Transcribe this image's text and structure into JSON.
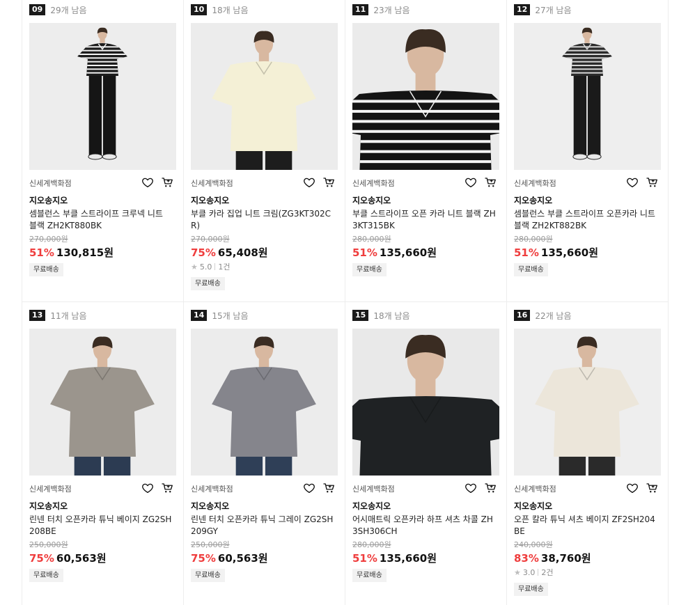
{
  "colors": {
    "discount": "#ef3d3d",
    "rank_bg": "#1a1a1a",
    "badge_bg": "#f2f2f2"
  },
  "icons": {
    "wishlist": "heart-icon",
    "cart": "cart-icon",
    "rating": "star-icon"
  },
  "products": [
    {
      "rank": "09",
      "remain": "29개 남음",
      "store": "신세계백화점",
      "brand": "지오송지오",
      "name": "셈블런스 부클 스트라이프 크루넥 니트 블랙 ZH2KT880BK",
      "original_price": "270,000원",
      "discount": "51%",
      "price": "130,815원",
      "rating": "",
      "reviews": "",
      "shipping": "무료배송",
      "shirt_color": "#1b1b1b",
      "pants_color": "#151515",
      "pattern": "stripes",
      "stripe_color": "#f2f2f2",
      "bg_color": "#ededed",
      "crop": "full"
    },
    {
      "rank": "10",
      "remain": "18개 남음",
      "store": "신세계백화점",
      "brand": "지오송지오",
      "name": "부클 카라 집업 니트 크림(ZG3KT302CR)",
      "original_price": "270,000원",
      "discount": "75%",
      "price": "65,408원",
      "rating": "5.0",
      "reviews": "1건",
      "shipping": "무료배송",
      "shirt_color": "#f4f0d6",
      "pants_color": "#1d1d1d",
      "pattern": "solid",
      "stripe_color": "",
      "bg_color": "#ececec",
      "crop": "mid"
    },
    {
      "rank": "11",
      "remain": "23개 남음",
      "store": "신세계백화점",
      "brand": "지오송지오",
      "name": "부클 스트라이프 오픈 카라 니트 블랙 ZH3KT315BK",
      "original_price": "280,000원",
      "discount": "51%",
      "price": "135,660원",
      "rating": "",
      "reviews": "",
      "shipping": "무료배송",
      "shirt_color": "#141414",
      "pants_color": "#141414",
      "pattern": "stripes",
      "stripe_color": "#f4f4f4",
      "bg_color": "#ebebeb",
      "crop": "close"
    },
    {
      "rank": "12",
      "remain": "27개 남음",
      "store": "신세계백화점",
      "brand": "지오송지오",
      "name": "셈블런스 부클 스트라이프 오픈카라 니트 블랙 ZH2KT882BK",
      "original_price": "280,000원",
      "discount": "51%",
      "price": "135,660원",
      "rating": "",
      "reviews": "",
      "shipping": "무료배송",
      "shirt_color": "#2a2a2a",
      "pants_color": "#1a1a1a",
      "pattern": "stripes",
      "stripe_color": "#d7d7d7",
      "bg_color": "#eeeeee",
      "crop": "full"
    },
    {
      "rank": "13",
      "remain": "11개 남음",
      "store": "신세계백화점",
      "brand": "지오송지오",
      "name": "린넨 터치 오픈카라 튜닉 베이지 ZG2SH208BE",
      "original_price": "250,000원",
      "discount": "75%",
      "price": "60,563원",
      "rating": "",
      "reviews": "",
      "shipping": "무료배송",
      "shirt_color": "#9b958d",
      "pants_color": "#2c3b52",
      "pattern": "solid",
      "stripe_color": "",
      "bg_color": "#ececec",
      "crop": "mid"
    },
    {
      "rank": "14",
      "remain": "15개 남음",
      "store": "신세계백화점",
      "brand": "지오송지오",
      "name": "린넨 터치 오픈카라 튜닉 그레이 ZG2SH209GY",
      "original_price": "250,000원",
      "discount": "75%",
      "price": "60,563원",
      "rating": "",
      "reviews": "",
      "shipping": "무료배송",
      "shirt_color": "#85858c",
      "pants_color": "#2f3f57",
      "pattern": "solid",
      "stripe_color": "",
      "bg_color": "#ececec",
      "crop": "mid"
    },
    {
      "rank": "15",
      "remain": "18개 남음",
      "store": "신세계백화점",
      "brand": "지오송지오",
      "name": "어시매트릭 오픈카라 하프 셔츠 차콜 ZH3SH306CH",
      "original_price": "280,000원",
      "discount": "51%",
      "price": "135,660원",
      "rating": "",
      "reviews": "",
      "shipping": "무료배송",
      "shirt_color": "#1f2224",
      "pants_color": "#1a1a1a",
      "pattern": "solid",
      "stripe_color": "",
      "bg_color": "#e9e9e9",
      "crop": "close"
    },
    {
      "rank": "16",
      "remain": "22개 남음",
      "store": "신세계백화점",
      "brand": "지오송지오",
      "name": "오픈 칼라 튜닉 셔츠 베이지 ZF2SH204BE",
      "original_price": "240,000원",
      "discount": "83%",
      "price": "38,760원",
      "rating": "3.0",
      "reviews": "2건",
      "shipping": "무료배송",
      "shirt_color": "#ece6da",
      "pants_color": "#2a2a2a",
      "pattern": "solid",
      "stripe_color": "",
      "bg_color": "#eeeeee",
      "crop": "mid"
    }
  ]
}
